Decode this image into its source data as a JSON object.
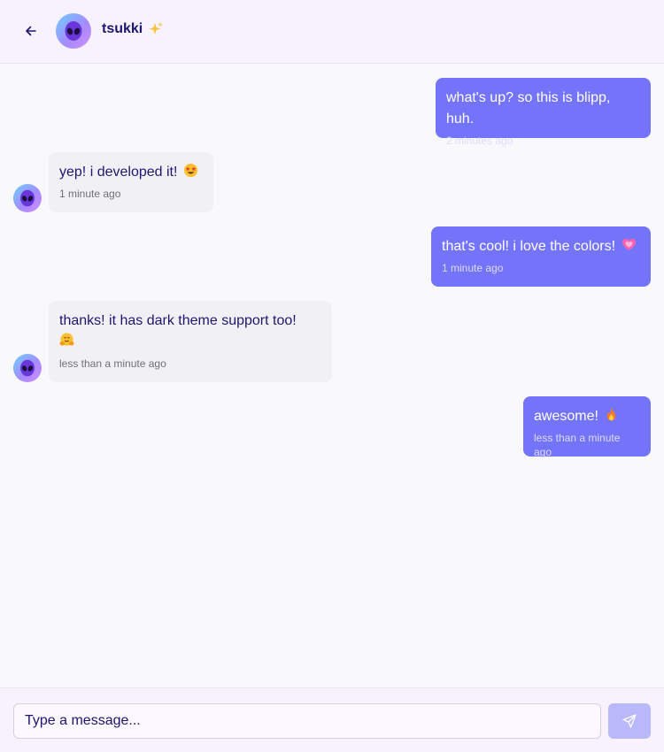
{
  "header": {
    "contact_name": "tsukki",
    "name_emoji": "sparkles-icon"
  },
  "messages": [
    {
      "direction": "outgoing",
      "text": "what's up? so this is blipp, huh.",
      "time": "2 minutes ago",
      "emoji": ""
    },
    {
      "direction": "incoming",
      "text": "yep! i developed it!",
      "time": "1 minute ago",
      "emoji": "star-struck-emoji"
    },
    {
      "direction": "outgoing",
      "text": "that's cool! i love the colors!",
      "time": "1 minute ago",
      "emoji": "pink-heart-emoji"
    },
    {
      "direction": "incoming",
      "text": "thanks! it has dark theme support too!",
      "time": "less than a minute ago",
      "emoji": "hugging-face-emoji"
    },
    {
      "direction": "outgoing",
      "text": "awesome!",
      "time": "less than a minute ago",
      "emoji": "fire-emoji"
    }
  ],
  "composer": {
    "placeholder": "Type a message...",
    "value": ""
  },
  "colors": {
    "accent": "#7474fb",
    "send_disabled": "#b8b8fb",
    "header_bg": "#f7f2fe",
    "incoming_bg": "#f1f1f5",
    "text_dark": "#1e1670"
  }
}
